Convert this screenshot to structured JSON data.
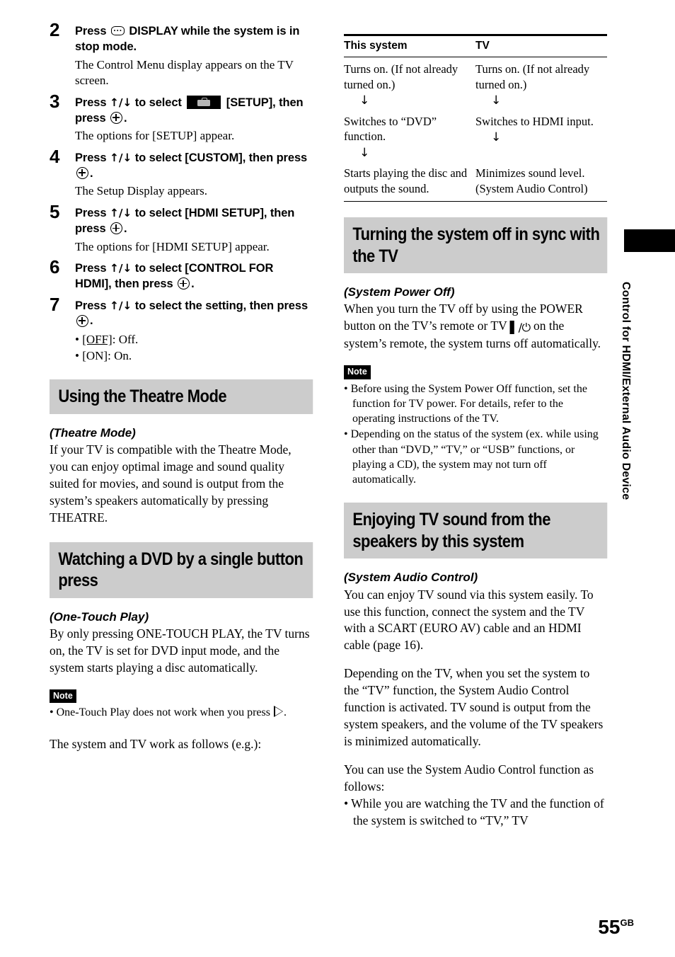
{
  "page": {
    "number": "55",
    "region_code": "GB"
  },
  "side_tab": {
    "label": "Control for HDMI/External Audio Device"
  },
  "left_column": {
    "steps": [
      {
        "num": "2",
        "head_before_icon": "Press ",
        "icon": "display-button-icon",
        "head_after_icon": " DISPLAY while the system is in stop mode.",
        "body": "The Control Menu display appears on the TV screen."
      },
      {
        "num": "3",
        "head_part1": "Press ",
        "arrows": "↑/↓",
        "head_part2": " to select ",
        "icon": "setup-toolbox-icon",
        "head_part3": " [SETUP], then press ",
        "enter_icon": "enter-button-icon",
        "head_part4": ".",
        "body": "The options for [SETUP] appear."
      },
      {
        "num": "4",
        "head_part1": "Press ",
        "arrows": "↑/↓",
        "head_part2": " to select [CUSTOM], then press ",
        "enter_icon": "enter-button-icon",
        "head_part3": ".",
        "body": "The Setup Display appears."
      },
      {
        "num": "5",
        "head_part1": "Press ",
        "arrows": "↑/↓",
        "head_part2": " to select [HDMI SETUP], then press ",
        "enter_icon": "enter-button-icon",
        "head_part3": ".",
        "body": "The options for [HDMI SETUP] appear."
      },
      {
        "num": "6",
        "head_part1": "Press ",
        "arrows": "↑/↓",
        "head_part2": " to select [CONTROL FOR HDMI], then press ",
        "enter_icon": "enter-button-icon",
        "head_part3": "."
      },
      {
        "num": "7",
        "head_part1": "Press ",
        "arrows": "↑/↓",
        "head_part2": " to select the setting, then press ",
        "enter_icon": "enter-button-icon",
        "head_part3": ".",
        "options": [
          {
            "bullet": "• ",
            "key": "[OFF]",
            "underline": true,
            "rest": ": Off."
          },
          {
            "bullet": "• ",
            "key": "[ON]",
            "underline": false,
            "rest": ": On."
          }
        ]
      }
    ],
    "theatre_section": {
      "heading": "Using the Theatre Mode",
      "subhead": "(Theatre Mode)",
      "paragraph": "If your TV is compatible with the Theatre Mode, you can enjoy optimal image and sound quality suited for movies, and sound is output from the system’s speakers automatically by pressing THEATRE."
    },
    "dvd_section": {
      "heading": "Watching a DVD by a single button press",
      "subhead": "(One-Touch Play)",
      "paragraph": "By only pressing ONE-TOUCH PLAY, the TV turns on, the TV is set for DVD input mode, and the system starts playing a disc automatically.",
      "note_badge": "Note",
      "note_before_icon": "• One-Touch Play does not work when you press ",
      "note_icon": "play-button-icon",
      "note_after_icon": ".",
      "closing": "The system and TV work as follows (e.g.):"
    }
  },
  "right_column": {
    "table": {
      "headers": [
        "This system",
        "TV"
      ],
      "rows": [
        {
          "system": "Turns on. (If not already turned on.)",
          "system_arrow": "↓",
          "tv": "Turns on. (If not already turned on.)",
          "tv_arrow": "↓"
        },
        {
          "system": "Switches to “DVD” function.",
          "system_arrow": "↓",
          "tv": "Switches to HDMI input.",
          "tv_arrow": "↓"
        },
        {
          "system": "Starts playing the disc and outputs the sound.",
          "system_arrow": "",
          "tv": "Minimizes sound level. (System Audio Control)",
          "tv_arrow": ""
        }
      ]
    },
    "power_off_section": {
      "heading": "Turning the system off in sync with the TV",
      "subhead": "(System Power Off)",
      "paragraph_part1": "When you turn the TV off by using the POWER button on the TV’s remote or TV ",
      "power_icon": "power-standby-icon",
      "power_glyph": "▌/⏻",
      "paragraph_part2": " on the system’s remote, the system turns off automatically.",
      "note_badge": "Note",
      "notes": [
        "• Before using the System Power Off function, set the function for TV power. For details, refer to the operating instructions of the TV.",
        "• Depending on the status of the system (ex. while using other than “DVD,” “TV,” or “USB” functions, or playing a CD), the system may not turn off automatically."
      ]
    },
    "audio_section": {
      "heading": "Enjoying TV sound from the speakers by this system",
      "subhead": "(System Audio Control)",
      "paragraph1": "You can enjoy TV sound via this system easily. To use this function, connect the system and the TV with a SCART (EURO AV) cable and an HDMI cable (page 16).",
      "paragraph2": "Depending on the TV, when you set the system to the “TV” function, the System Audio Control function is activated. TV sound is output from the system speakers, and the volume of the TV speakers is minimized automatically.",
      "paragraph3": "You can use the System Audio Control function as follows:",
      "bullets": [
        "• While you are watching the TV and the function of the system is switched to “TV,” TV"
      ]
    }
  },
  "colors": {
    "band_gray": "#cccccc",
    "ink": "#000000",
    "paper": "#ffffff"
  }
}
